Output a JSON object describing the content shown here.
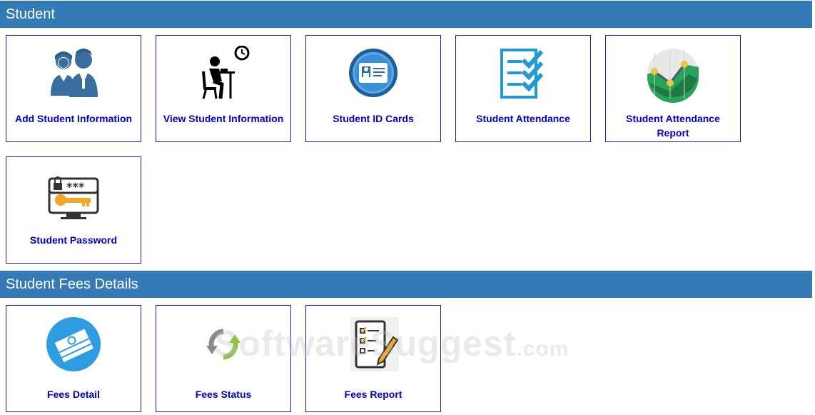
{
  "sections": [
    {
      "title": "Student"
    },
    {
      "title": "Student Fees Details"
    }
  ],
  "student_tiles": [
    {
      "label": "Add Student Information",
      "icon": "students-icon"
    },
    {
      "label": "View Student Information",
      "icon": "person-reading-clock-icon"
    },
    {
      "label": "Student ID Cards",
      "icon": "id-card-icon"
    },
    {
      "label": "Student Attendance",
      "icon": "checklist-icon"
    },
    {
      "label": "Student Attendance Report",
      "icon": "line-chart-icon"
    },
    {
      "label": "Student Password",
      "icon": "password-key-icon"
    }
  ],
  "fees_tiles": [
    {
      "label": "Fees Detail",
      "icon": "money-stack-icon"
    },
    {
      "label": "Fees Status",
      "icon": "refresh-arrows-icon"
    },
    {
      "label": "Fees Report",
      "icon": "report-pencil-icon"
    }
  ],
  "watermark": {
    "brand": "SoftwareSuggest",
    "suffix": ".com"
  },
  "colors": {
    "header_bg": "#337ab7",
    "tile_border": "#1b1bb0",
    "label": "#0000cc"
  }
}
